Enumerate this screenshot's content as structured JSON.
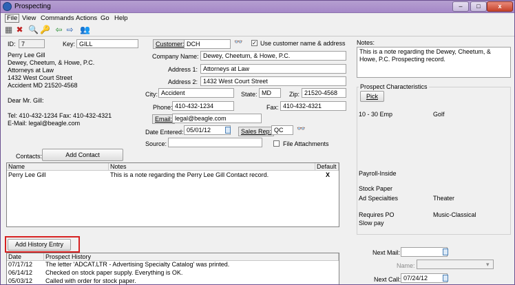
{
  "window": {
    "title": "Prospecting",
    "minimize": "–",
    "maximize": "□",
    "close": "x"
  },
  "menu": [
    "File",
    "View",
    "Commands",
    "Actions",
    "Go",
    "Help"
  ],
  "toolbar": {
    "icons": [
      "new-record-icon",
      "delete-icon",
      "search-icon",
      "key-icon",
      "back-arrow-icon",
      "forward-arrow-icon",
      "people-icon"
    ],
    "glyphs": [
      "▦",
      "✖",
      "🔍",
      "🔑",
      "⇦",
      "⇨",
      "👥"
    ]
  },
  "id": {
    "label": "ID:",
    "value": "7"
  },
  "key": {
    "label": "Key:",
    "value": "GILL"
  },
  "address_block": [
    "Perry Lee Gill",
    "Dewey, Cheetum, & Howe, P.C.",
    "Attorneys at Law",
    "1432 West Court Street",
    "Accident  MD  21520-4568",
    "",
    "Dear Mr. Gill:",
    "",
    "Tel: 410-432-1234    Fax: 410-432-4321",
    "E-Mail: legal@beagle.com"
  ],
  "customer": {
    "label": "Customer:",
    "value": "DCH"
  },
  "use_customer": {
    "label": "Use customer name & address",
    "checked": "✓"
  },
  "company": {
    "label": "Company Name:",
    "value": "Dewey, Cheetum, & Howe, P.C."
  },
  "address1": {
    "label": "Address 1:",
    "value": "Attorneys at Law"
  },
  "address2": {
    "label": "Address 2:",
    "value": "1432 West Court Street"
  },
  "city": {
    "label": "City:",
    "value": "Accident"
  },
  "state": {
    "label": "State:",
    "value": "MD"
  },
  "zip": {
    "label": "Zip:",
    "value": "21520-4568"
  },
  "phone": {
    "label": "Phone:",
    "value": "410-432-1234"
  },
  "fax": {
    "label": "Fax:",
    "value": "410-432-4321"
  },
  "email": {
    "label": "Email:",
    "value": "legal@beagle.com"
  },
  "date_entered": {
    "label": "Date Entered:",
    "value": "05/01/12"
  },
  "sales_rep": {
    "label": "Sales Rep:",
    "value": "QC"
  },
  "source": {
    "label": "Source:",
    "value": ""
  },
  "file_attachments": {
    "label": "File Attachments"
  },
  "notes": {
    "label": "Notes:",
    "text": "This is a note regarding the Dewey, Cheetum, & Howe, P.C. Prospecting record."
  },
  "characteristics": {
    "label": "Prospect Characteristics",
    "pick": "Pick",
    "rows": [
      [
        "10 - 30 Emp",
        "Golf"
      ],
      [
        "",
        ""
      ],
      [
        "",
        ""
      ],
      [
        "",
        ""
      ],
      [
        "",
        ""
      ],
      [
        "",
        ""
      ],
      [
        "",
        ""
      ],
      [
        "Payroll-Inside",
        ""
      ],
      [
        "",
        ""
      ],
      [
        "Stock Paper",
        ""
      ],
      [
        "Ad Specialties",
        "Theater"
      ],
      [
        "",
        ""
      ],
      [
        "Requires PO",
        "Music-Classical"
      ],
      [
        "Slow pay",
        ""
      ]
    ]
  },
  "contacts": {
    "label": "Contacts:",
    "add_button": "Add Contact",
    "headers": [
      "Name",
      "Notes",
      "Default"
    ],
    "rows": [
      {
        "name": "Perry Lee Gill",
        "notes": "This is a note regarding the Perry Lee Gill Contact record.",
        "default": "X"
      }
    ]
  },
  "history": {
    "add_button": "Add History Entry",
    "headers": [
      "Date",
      "Prospect History"
    ],
    "rows": [
      {
        "date": "07/17/12",
        "text": "The letter 'ADCAT.LTR - Advertising Specialty Catalog' was printed."
      },
      {
        "date": "06/14/12",
        "text": "Checked on stock paper supply.  Everything is OK."
      },
      {
        "date": "05/03/12",
        "text": "Called with order for stock paper."
      }
    ]
  },
  "next_mail": {
    "label": "Next Mail:",
    "value": ""
  },
  "name": {
    "label": "Name:",
    "value": ""
  },
  "next_call": {
    "label": "Next Call:",
    "value": "07/24/12"
  }
}
